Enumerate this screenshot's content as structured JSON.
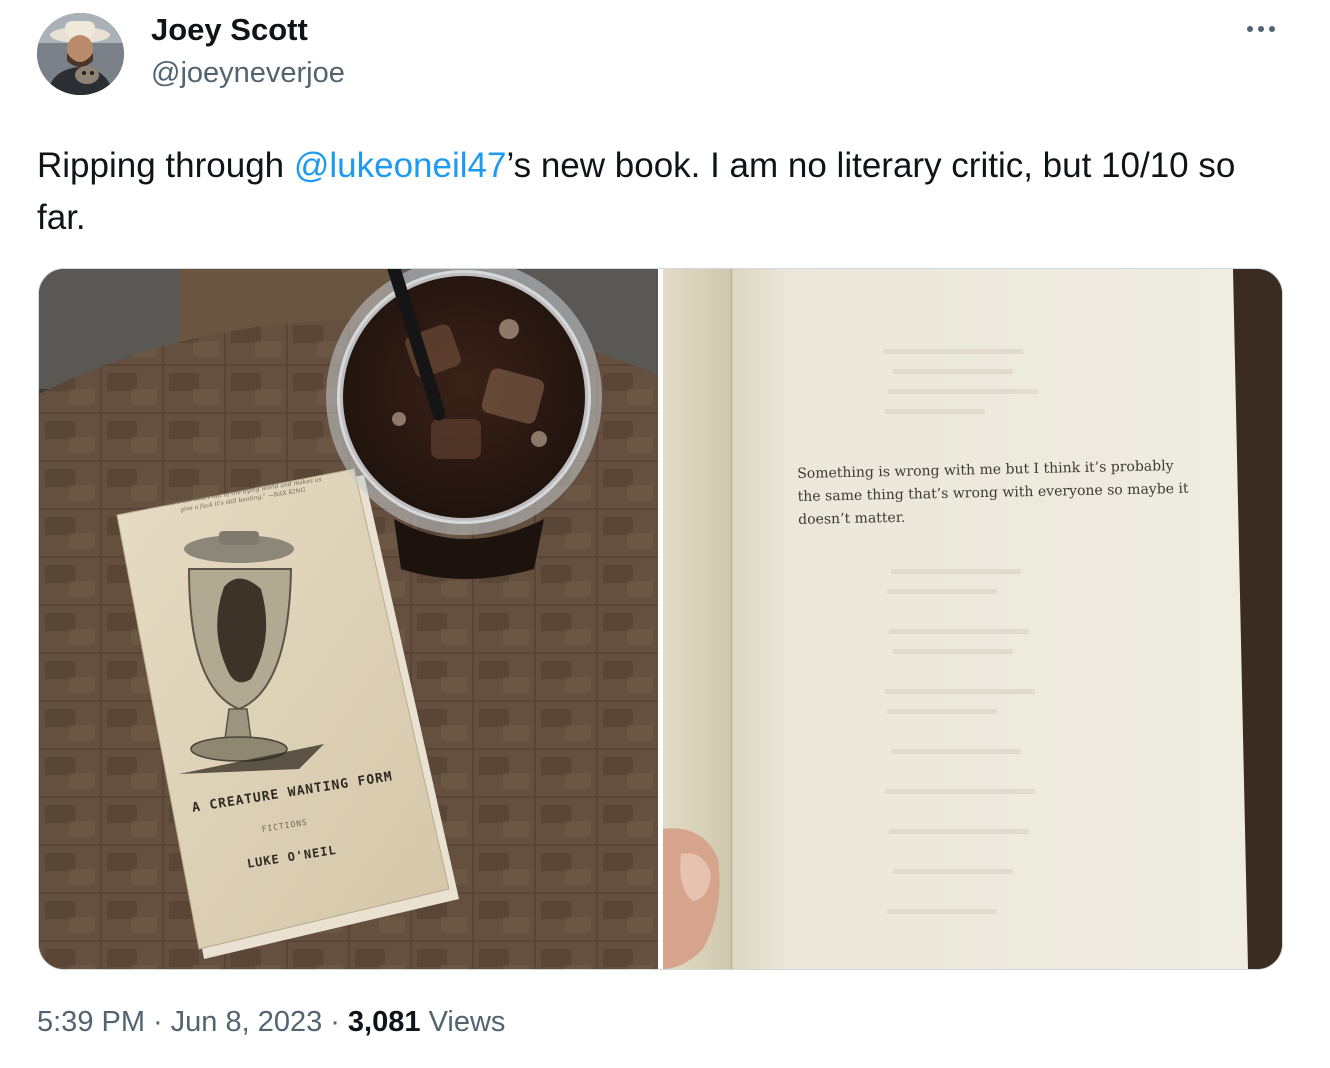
{
  "author": {
    "name": "Joey Scott",
    "handle": "@joeyneverjoe"
  },
  "tweet": {
    "text_before": "Ripping through ",
    "mention": "@lukeoneil47",
    "text_after": "’s new book. I am no literary critic, but 10/10 so far."
  },
  "media": {
    "photo_left": {
      "cover_blurb": "\"Tears the heart out of the dying world and makes us give a fuck it's still beating.\" —RAX KING",
      "cover_title": "A CREATURE WANTING FORM",
      "cover_subtitle": "FICTIONS",
      "cover_author": "LUKE O'NEIL"
    },
    "photo_right": {
      "page_quote": "Something is wrong with me but I think it’s probably the same thing that’s wrong with everyone so maybe it doesn’t matter."
    }
  },
  "meta": {
    "time": "5:39 PM",
    "date": "Jun 8, 2023",
    "separator": "·",
    "views_count": "3,081",
    "views_label": "Views"
  },
  "colors": {
    "link": "#1d9bf0",
    "secondary_text": "#536471",
    "primary_text": "#0f1419",
    "border": "#cfd9de"
  },
  "icons": [
    "more-options-icon"
  ]
}
